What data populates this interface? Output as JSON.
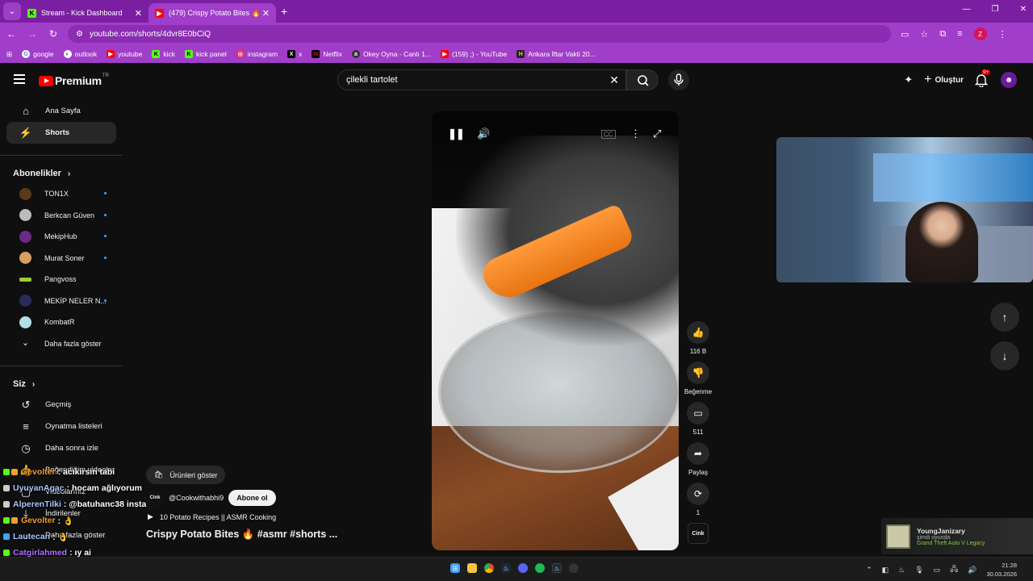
{
  "browser": {
    "tabs": [
      {
        "title": "Stream - Kick Dashboard",
        "icon": "kick-icon",
        "active": false
      },
      {
        "title": "(479) Crispy Potato Bites 🔥 🔊",
        "icon": "youtube-icon",
        "active": true
      }
    ],
    "url": "youtube.com/shorts/4dvr8E0bCiQ",
    "profile_letter": "Z",
    "bookmarks": [
      {
        "label": "google",
        "icon": "google-icon",
        "color": "#ffffff"
      },
      {
        "label": "outlook",
        "icon": "outlook-icon",
        "color": "#ffffff"
      },
      {
        "label": "youtube",
        "icon": "youtube-icon",
        "color": "#ff0000"
      },
      {
        "label": "kick",
        "icon": "kick-icon",
        "color": "#53fc18"
      },
      {
        "label": "kick panel",
        "icon": "kick-icon",
        "color": "#53fc18"
      },
      {
        "label": "instagram",
        "icon": "instagram-icon",
        "color": "#e1306c"
      },
      {
        "label": "x",
        "icon": "x-icon",
        "color": "#000000"
      },
      {
        "label": "Netflix",
        "icon": "netflix-icon",
        "color": "#e50914"
      },
      {
        "label": "Okey Oyna - Canlı 1...",
        "icon": "okey-icon",
        "color": "#333333"
      },
      {
        "label": "(159) ;) - YouTube",
        "icon": "youtube-icon",
        "color": "#ff0000"
      },
      {
        "label": "Ankara İftar Vakti 20...",
        "icon": "hurriyet-icon",
        "color": "#222222"
      }
    ]
  },
  "youtube": {
    "logo_word": "Premium",
    "logo_country": "TR",
    "search_value": "çilekli tartolet",
    "create_label": "Oluştur",
    "notif_count": "9+",
    "sidebar": {
      "main": [
        {
          "label": "Ana Sayfa",
          "icon": "home-icon",
          "active": false
        },
        {
          "label": "Shorts",
          "icon": "shorts-icon",
          "active": true
        }
      ],
      "subs_title": "Abonelikler",
      "subs": [
        {
          "label": "TON1X",
          "color": "#5a3a1a",
          "dot": true
        },
        {
          "label": "Berkcan Güven",
          "color": "#bbbbbb",
          "dot": true
        },
        {
          "label": "MekipHub",
          "color": "#6a2a8a",
          "dot": true
        },
        {
          "label": "Murat Soner",
          "color": "#d8a060",
          "dot": true
        },
        {
          "label": "Pangvoss",
          "color": "#9acd32",
          "dot": false
        },
        {
          "label": "MEKİP NELER N...",
          "color": "#2a2a5a",
          "dot": true
        },
        {
          "label": "KombatR",
          "color": "#b0e0e6",
          "dot": false
        }
      ],
      "show_more": "Daha fazla göster",
      "you_title": "Siz",
      "you": [
        {
          "label": "Geçmiş",
          "icon": "history-icon"
        },
        {
          "label": "Oynatma listeleri",
          "icon": "playlist-icon"
        },
        {
          "label": "Daha sonra izle",
          "icon": "clock-icon"
        },
        {
          "label": "Beğendiğim videolar",
          "icon": "like-icon"
        },
        {
          "label": "Videolarınız",
          "icon": "video-icon"
        },
        {
          "label": "İndirilenler",
          "icon": "download-icon"
        },
        {
          "label": "Daha fazla göster",
          "icon": "chevron-down-icon"
        }
      ]
    },
    "short": {
      "likes": "116 B",
      "dislike_label": "Beğenme",
      "comments": "511",
      "share_label": "Paylaş",
      "remix_count": "1",
      "channel_badge": "Cink",
      "products_label": "Ürünleri göster",
      "channel": "@Cookwithabhi9",
      "subscribe_label": "Abone ol",
      "playlist": "10 Potato Recipes || ASMR Cooking",
      "title": "Crispy Potato Bites 🔥 #asmr #shorts ..."
    }
  },
  "chat": [
    {
      "user": "Gevolter",
      "color": "#f0a030",
      "msg": ": acıkırsın tabi"
    },
    {
      "user": "UyuyanAgac",
      "color": "#a8c8ff",
      "msg": ": hocam ağlıyorum"
    },
    {
      "user": "AlperenTilki",
      "color": "#a8c8ff",
      "msg": ": @batuhanc38 insta"
    },
    {
      "user": "Gevolter",
      "color": "#f0a030",
      "msg": ": 👌"
    },
    {
      "user": "Lautecan",
      "color": "#a8c8ff",
      "msg": ": 👌"
    },
    {
      "user": "Catgirlahmed",
      "color": "#b070ff",
      "msg": ": ıy ai"
    }
  ],
  "game_notification": {
    "name": "YoungJanizary",
    "status": "şimdi oyunda",
    "game": "Grand Theft Auto V Legacy"
  },
  "taskbar": {
    "time": "21:28",
    "date": "30.03.2026"
  }
}
